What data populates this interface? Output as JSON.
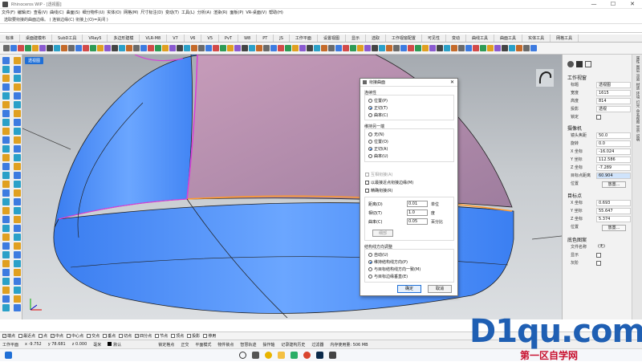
{
  "window": {
    "title": "Rhinoceros WIP - [透视图]",
    "controls": [
      "—",
      "☐",
      "✕"
    ]
  },
  "menu": [
    "文件(F)",
    "编辑(E)",
    "查看(V)",
    "曲线(C)",
    "曲面(S)",
    "细分物件(U)",
    "实体(O)",
    "网格(M)",
    "尺寸标注(D)",
    "变动(T)",
    "工具(L)",
    "分析(A)",
    "渲染(R)",
    "面板(P)",
    "VR-桌面(V)",
    "帮助(H)"
  ],
  "command": {
    "history": "选取要衔接的曲面边缘。 ( 连锁边缘(C) 衔接上(O)=关闭 )",
    "prompt": ""
  },
  "tabs": [
    {
      "label": "标准",
      "active": false
    },
    {
      "label": "桌面建模布",
      "active": false
    },
    {
      "label": "SubD工具",
      "active": false
    },
    {
      "label": "VRay5",
      "active": false
    },
    {
      "label": "多边形建模",
      "active": false
    },
    {
      "label": "VLR-M8",
      "active": false
    },
    {
      "label": "V7",
      "active": false
    },
    {
      "label": "V6",
      "active": false
    },
    {
      "label": "V5",
      "active": false
    },
    {
      "label": "PvT",
      "active": false
    },
    {
      "label": "W8",
      "active": false
    },
    {
      "label": "PT",
      "active": false
    },
    {
      "label": "JS",
      "active": false
    },
    {
      "label": "工作平面",
      "active": false
    },
    {
      "label": "设置视图",
      "active": false
    },
    {
      "label": "显示",
      "active": false
    },
    {
      "label": "选取",
      "active": false
    },
    {
      "label": "工作视窗配置",
      "active": false
    },
    {
      "label": "可见性",
      "active": false
    },
    {
      "label": "变动",
      "active": false
    },
    {
      "label": "曲线工具",
      "active": false
    },
    {
      "label": "曲面工具",
      "active": false
    },
    {
      "label": "实体工具",
      "active": false
    },
    {
      "label": "网格工具",
      "active": false
    }
  ],
  "viewport": {
    "label": "透视图"
  },
  "dialog": {
    "title": "衔接曲面",
    "close": "✕",
    "continuity": {
      "label": "连续性",
      "options": [
        {
          "label": "位置(P)",
          "selected": false
        },
        {
          "label": "正切(T)",
          "selected": true
        },
        {
          "label": "曲率(C)",
          "selected": false
        }
      ]
    },
    "preserve": {
      "label": "维持另一端",
      "options": [
        {
          "label": "无(N)",
          "selected": false
        },
        {
          "label": "位置(O)",
          "selected": false
        },
        {
          "label": "正切(A)",
          "selected": true
        },
        {
          "label": "曲率(U)",
          "selected": false
        }
      ]
    },
    "checks": [
      {
        "label": "互相衔接(A)",
        "checked": false,
        "disabled": true
      },
      {
        "label": "以最接近点衔接边缘(M)",
        "checked": false,
        "disabled": false
      },
      {
        "label": "精确衔接(R)",
        "checked": false,
        "disabled": false
      }
    ],
    "fields": [
      {
        "label": "距离(D)",
        "value": "0.01",
        "unit": "单位"
      },
      {
        "label": "相切(T)",
        "value": "1.0",
        "unit": "度"
      },
      {
        "label": "曲率(C)",
        "value": "0.05",
        "unit": "百分比"
      }
    ],
    "refine_button": "细部",
    "structure": {
      "label": "结构线方向调整",
      "options": [
        {
          "label": "自动(U)",
          "selected": false
        },
        {
          "label": "维持结构线方向(P)",
          "selected": true
        },
        {
          "label": "与目标结构线方向一致(M)",
          "selected": false
        },
        {
          "label": "与目标边缘垂直(E)",
          "selected": false
        }
      ]
    },
    "ok": "确定",
    "cancel": "取消"
  },
  "properties": {
    "section_viewport": "工作视窗",
    "title_label": "标题",
    "title_value": "透视图",
    "width_label": "宽度",
    "width_value": "1615",
    "height_label": "高度",
    "height_value": "814",
    "projection_label": "投影",
    "projection_value": "透视",
    "lock_label": "锁定",
    "section_camera": "摄像机",
    "lens_label": "镜头焦距",
    "lens_value": "50.0",
    "rotation_label": "旋转",
    "rotation_value": "0.0",
    "cx_label": "X 坐标",
    "cx_value": "-16.024",
    "cy_label": "Y 坐标",
    "cy_value": "112.586",
    "cz_label": "Z 坐标",
    "cz_value": "-7.289",
    "dist_label": "目标点距离",
    "dist_value": "60.904",
    "cam_pos_label": "位置",
    "place_button": "放置...",
    "section_target": "目标点",
    "tx_label": "X 坐标",
    "tx_value": "0.693",
    "ty_label": "Y 坐标",
    "ty_value": "55.647",
    "tz_label": "Z 坐标",
    "tz_value": "5.374",
    "tgt_pos_label": "位置",
    "section_wallpaper": "底色图案",
    "file_label": "文件名称",
    "file_value": "(无)",
    "show_label": "显示",
    "gray_label": "灰阶",
    "strip": [
      "属性",
      "图层",
      "渲染",
      "材质",
      "环境",
      "灯光",
      "命名视图",
      "显示",
      "说明"
    ]
  },
  "osnap": [
    {
      "label": "端点",
      "checked": true
    },
    {
      "label": "最近点",
      "checked": false
    },
    {
      "label": "点",
      "checked": false
    },
    {
      "label": "中点",
      "checked": true
    },
    {
      "label": "中心点",
      "checked": false
    },
    {
      "label": "交点",
      "checked": false
    },
    {
      "label": "垂点",
      "checked": false
    },
    {
      "label": "切点",
      "checked": false
    },
    {
      "label": "四分点",
      "checked": true
    },
    {
      "label": "节点",
      "checked": false
    },
    {
      "label": "顶点",
      "checked": false
    },
    {
      "label": "投影",
      "checked": false
    },
    {
      "label": "停用",
      "checked": false
    }
  ],
  "status": {
    "cplane": "工作平面",
    "x": "x -9.752",
    "y": "y 78.681",
    "z": "z 0.000",
    "unit": "毫米",
    "layer": "默认",
    "items": [
      "锁定格点",
      "正交",
      "平面模式",
      "物件锁点",
      "智慧轨迹",
      "操作轴",
      "记录建构历史",
      "过滤器"
    ],
    "memory": "内存使用量: 506 MB"
  },
  "watermark": {
    "main": "D1qu.com",
    "sub": "第一区自学网"
  },
  "colors": {
    "accent": "#1f6fd6",
    "surface_blue": "#4f8ff7",
    "surface_pink": "#c49bb5",
    "edge_magenta": "#d641d6",
    "edge_orange": "#ff9a2e"
  }
}
